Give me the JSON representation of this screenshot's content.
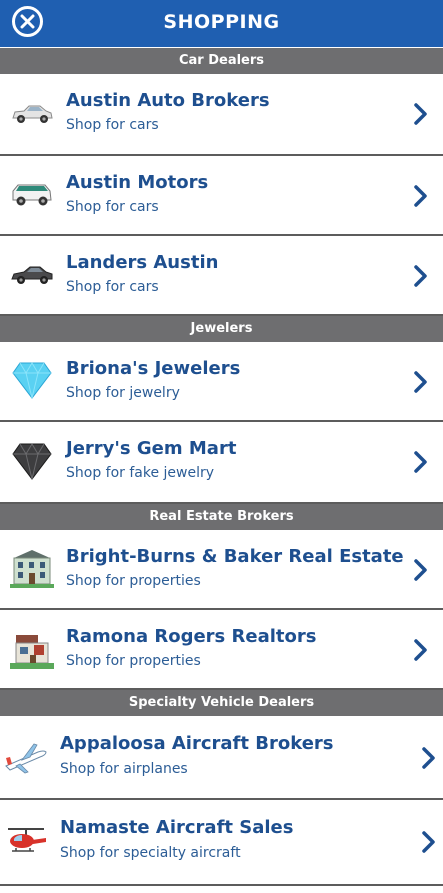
{
  "header": {
    "title": "SHOPPING",
    "close_icon": "close-circle-icon"
  },
  "sections": [
    {
      "title": "Car Dealers",
      "items": [
        {
          "name": "Austin Auto Brokers",
          "sub": "Shop for cars",
          "icon": "sedan-car-icon"
        },
        {
          "name": "Austin Motors",
          "sub": "Shop for cars",
          "icon": "suv-car-icon"
        },
        {
          "name": "Landers Austin",
          "sub": "Shop for cars",
          "icon": "luxury-car-icon"
        }
      ]
    },
    {
      "title": "Jewelers",
      "items": [
        {
          "name": "Briona's Jewelers",
          "sub": "Shop for jewelry",
          "icon": "diamond-icon"
        },
        {
          "name": "Jerry's Gem Mart",
          "sub": "Shop for fake jewelry",
          "icon": "black-diamond-icon"
        }
      ]
    },
    {
      "title": "Real Estate Brokers",
      "items": [
        {
          "name": "Bright-Burns & Baker Real Estate",
          "sub": "Shop for properties",
          "icon": "mansion-icon"
        },
        {
          "name": "Ramona Rogers Realtors",
          "sub": "Shop for properties",
          "icon": "house-icon"
        }
      ]
    },
    {
      "title": "Specialty Vehicle Dealers",
      "items": [
        {
          "name": "Appaloosa Aircraft Brokers",
          "sub": "Shop for airplanes",
          "icon": "airplane-icon"
        },
        {
          "name": "Namaste Aircraft Sales",
          "sub": "Shop for specialty aircraft",
          "icon": "helicopter-icon"
        }
      ]
    }
  ],
  "colors": {
    "header": "#1f5fb1",
    "section": "#6e6e70",
    "name": "#1e4f8f",
    "sub": "#2c5d96",
    "chevron": "#1e4f8f"
  }
}
